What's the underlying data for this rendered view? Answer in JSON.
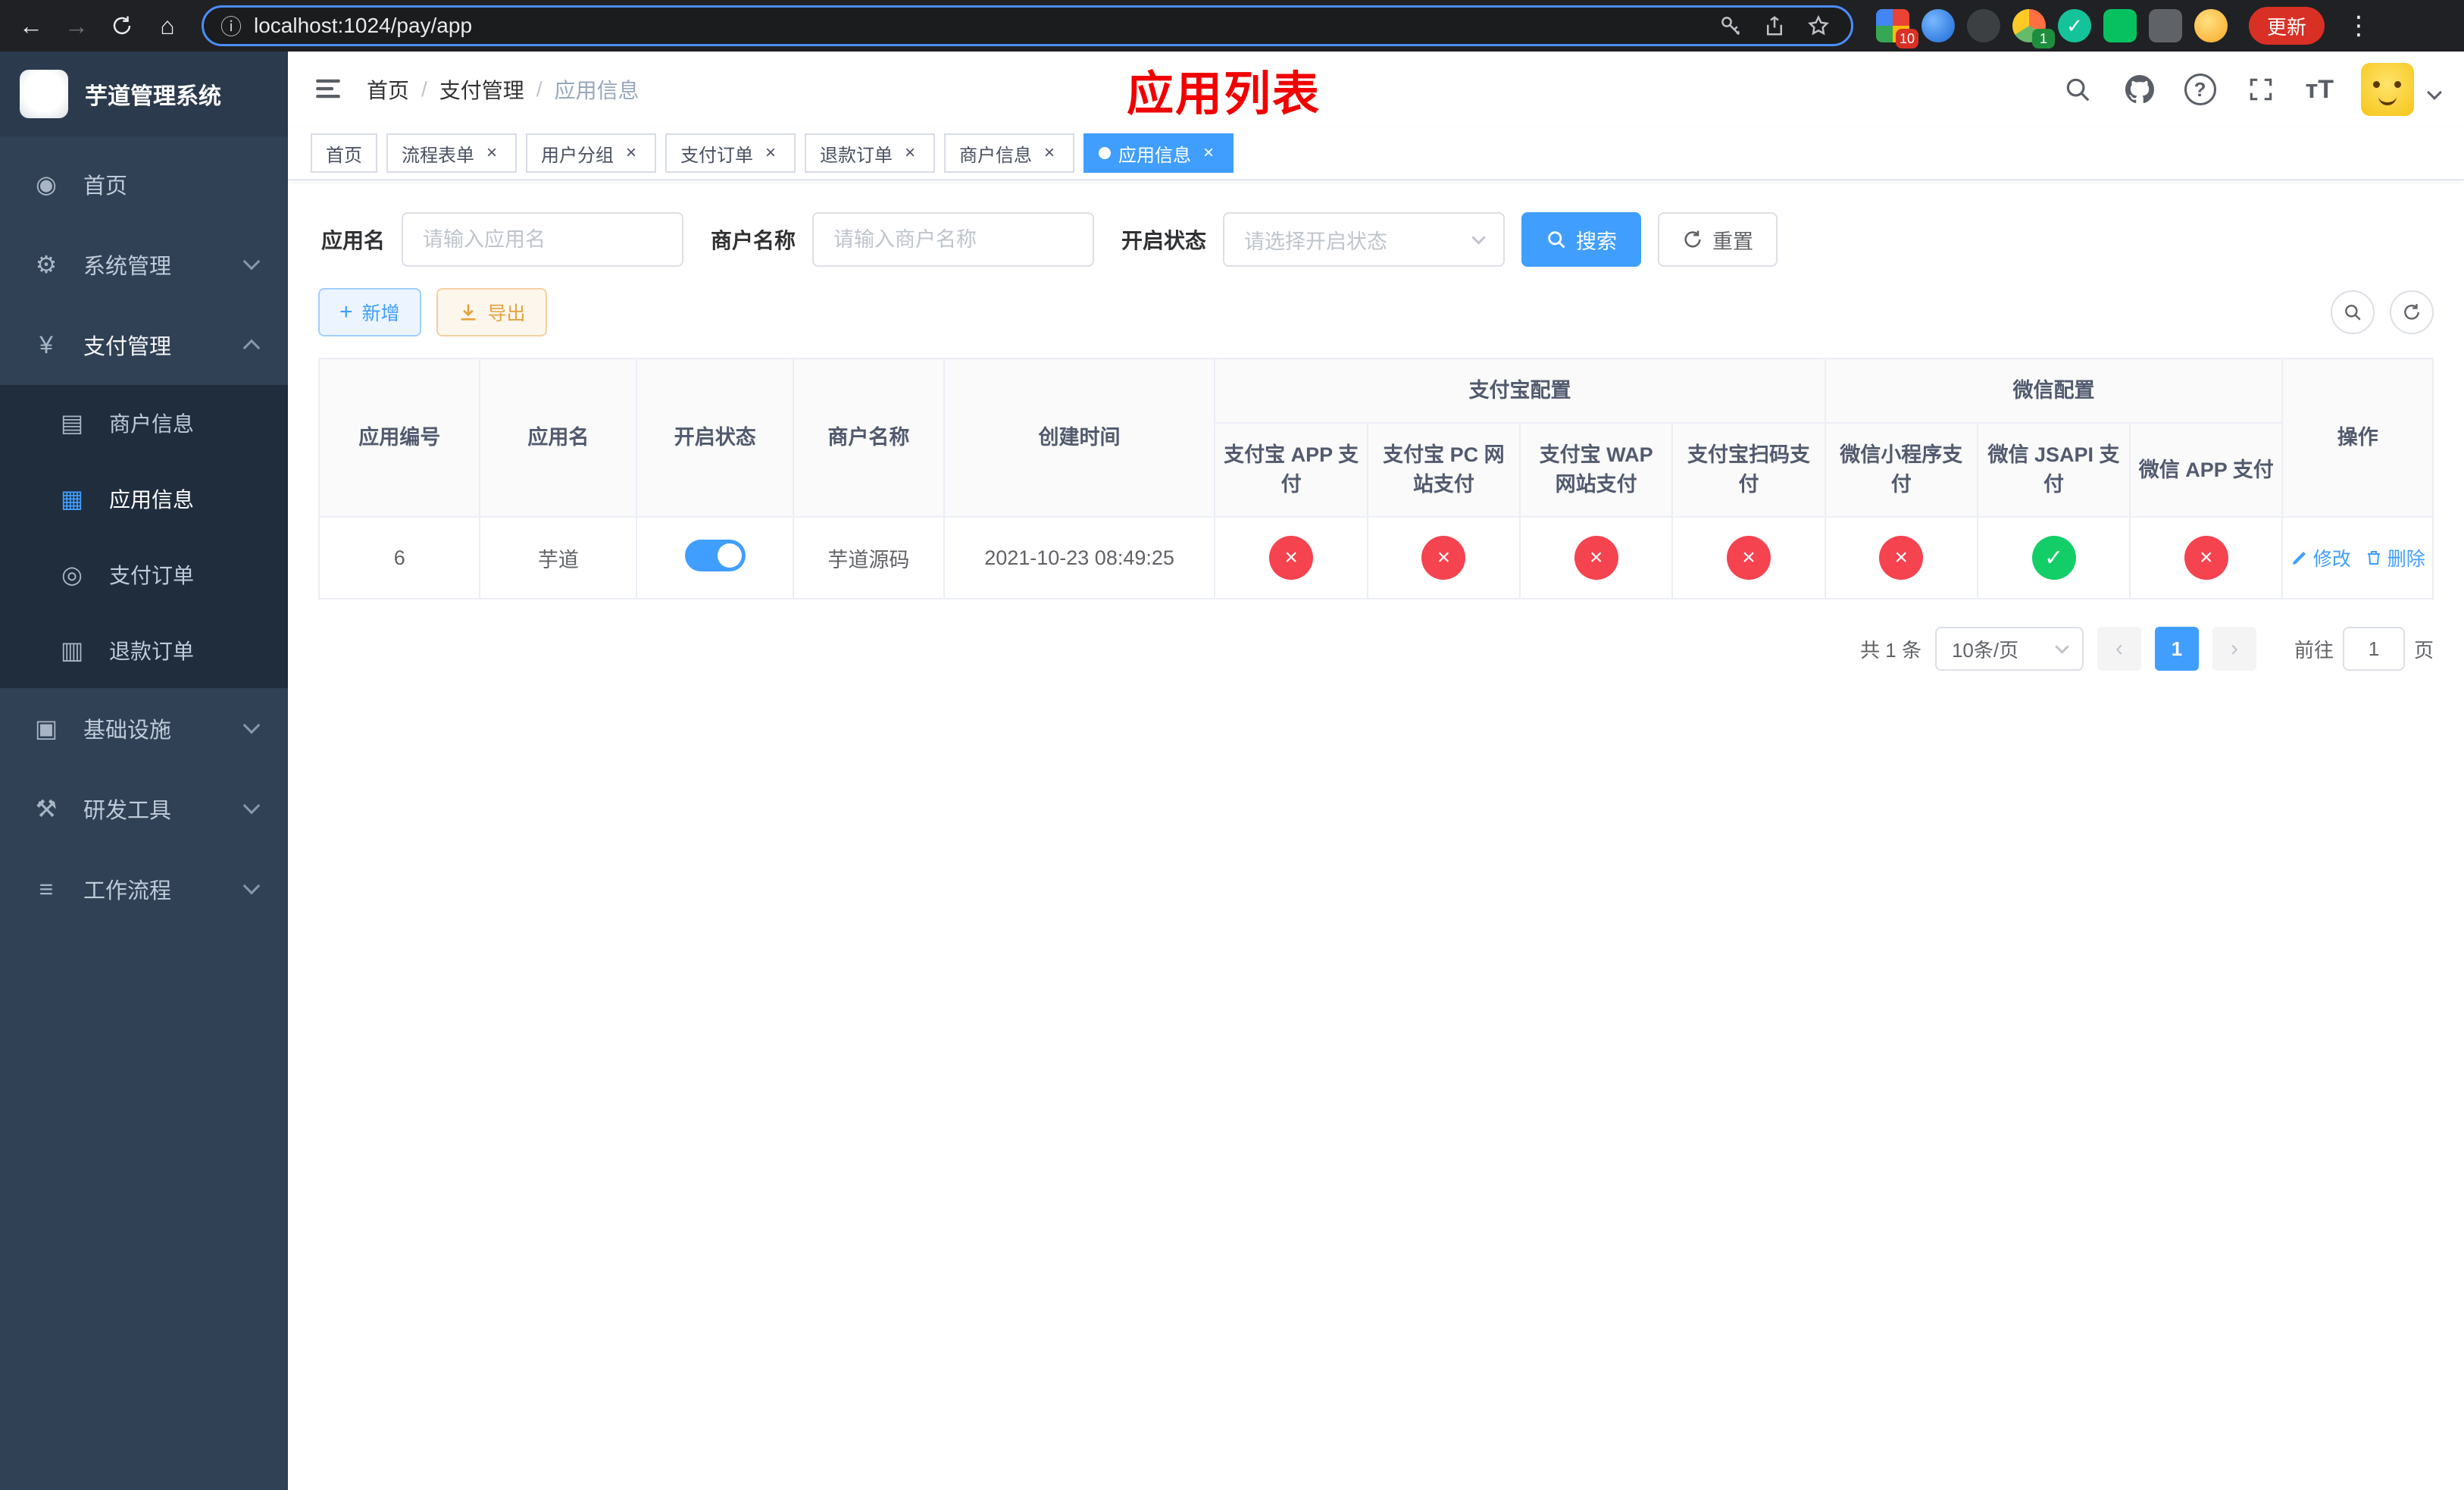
{
  "browser": {
    "url": "localhost:1024/pay/app",
    "update_label": "更新",
    "ext_badge_grid": "10",
    "ext_badge_avatar": "1"
  },
  "icons": {
    "back": "←",
    "forward": "→",
    "home": "⌂",
    "info": "ⓘ",
    "dots": "⋮",
    "close": "×",
    "separator": "/",
    "question": "?",
    "font_size": "тT",
    "plus": "+",
    "check": "✓",
    "prev": "‹",
    "next": "›",
    "dashboard": "◉",
    "gear": "⚙",
    "yen": "¥",
    "merchant_card": "▤",
    "app_grid": "▦",
    "order_circle": "◎",
    "refund_doc": "▥",
    "infra": "▣",
    "devtools": "⚒",
    "workflow": "≡"
  },
  "sidebar": {
    "title": "芋道管理系统",
    "items": {
      "home": "首页",
      "system": "系统管理",
      "payment": "支付管理",
      "merchant": "商户信息",
      "app": "应用信息",
      "pay_order": "支付订单",
      "refund_order": "退款订单",
      "infra": "基础设施",
      "devtools": "研发工具",
      "workflow": "工作流程"
    }
  },
  "navbar": {
    "breadcrumb": {
      "home": "首页",
      "section": "支付管理",
      "current": "应用信息"
    },
    "annotation": "应用列表"
  },
  "tabs": [
    {
      "label": "首页"
    },
    {
      "label": "流程表单"
    },
    {
      "label": "用户分组"
    },
    {
      "label": "支付订单"
    },
    {
      "label": "退款订单"
    },
    {
      "label": "商户信息"
    },
    {
      "label": "应用信息"
    }
  ],
  "filters": {
    "app_name_label": "应用名",
    "app_name_placeholder": "请输入应用名",
    "merchant_label": "商户名称",
    "merchant_placeholder": "请输入商户名称",
    "status_label": "开启状态",
    "status_placeholder": "请选择开启状态",
    "search_label": "搜索",
    "reset_label": "重置"
  },
  "toolbar": {
    "add_label": "新增",
    "export_label": "导出"
  },
  "table": {
    "header": {
      "app_id": "应用编号",
      "app_name": "应用名",
      "status": "开启状态",
      "merchant": "商户名称",
      "created": "创建时间",
      "alipay_group": "支付宝配置",
      "wechat_group": "微信配置",
      "alipay_app": "支付宝 APP 支付",
      "alipay_pc": "支付宝 PC 网站支付",
      "alipay_wap": "支付宝 WAP 网站支付",
      "alipay_qr": "支付宝扫码支付",
      "wechat_mini": "微信小程序支付",
      "wechat_jsapi": "微信 JSAPI 支付",
      "wechat_app": "微信 APP 支付",
      "operations": "操作"
    },
    "row": {
      "app_id": "6",
      "app_name": "芋道",
      "status_on": true,
      "merchant": "芋道源码",
      "created": "2021-10-23 08:49:25",
      "channels": [
        false,
        false,
        false,
        false,
        false,
        true,
        false
      ],
      "edit_label": "修改",
      "delete_label": "删除"
    }
  },
  "pagination": {
    "total": "共 1 条",
    "page_size": "10条/页",
    "current_page": "1",
    "goto_label": "前往",
    "goto_value": "1",
    "page_unit": "页"
  },
  "colors": {
    "primary": "#409eff",
    "danger": "#f5434f",
    "success": "#13ce66",
    "warning": "#e6a23c"
  }
}
